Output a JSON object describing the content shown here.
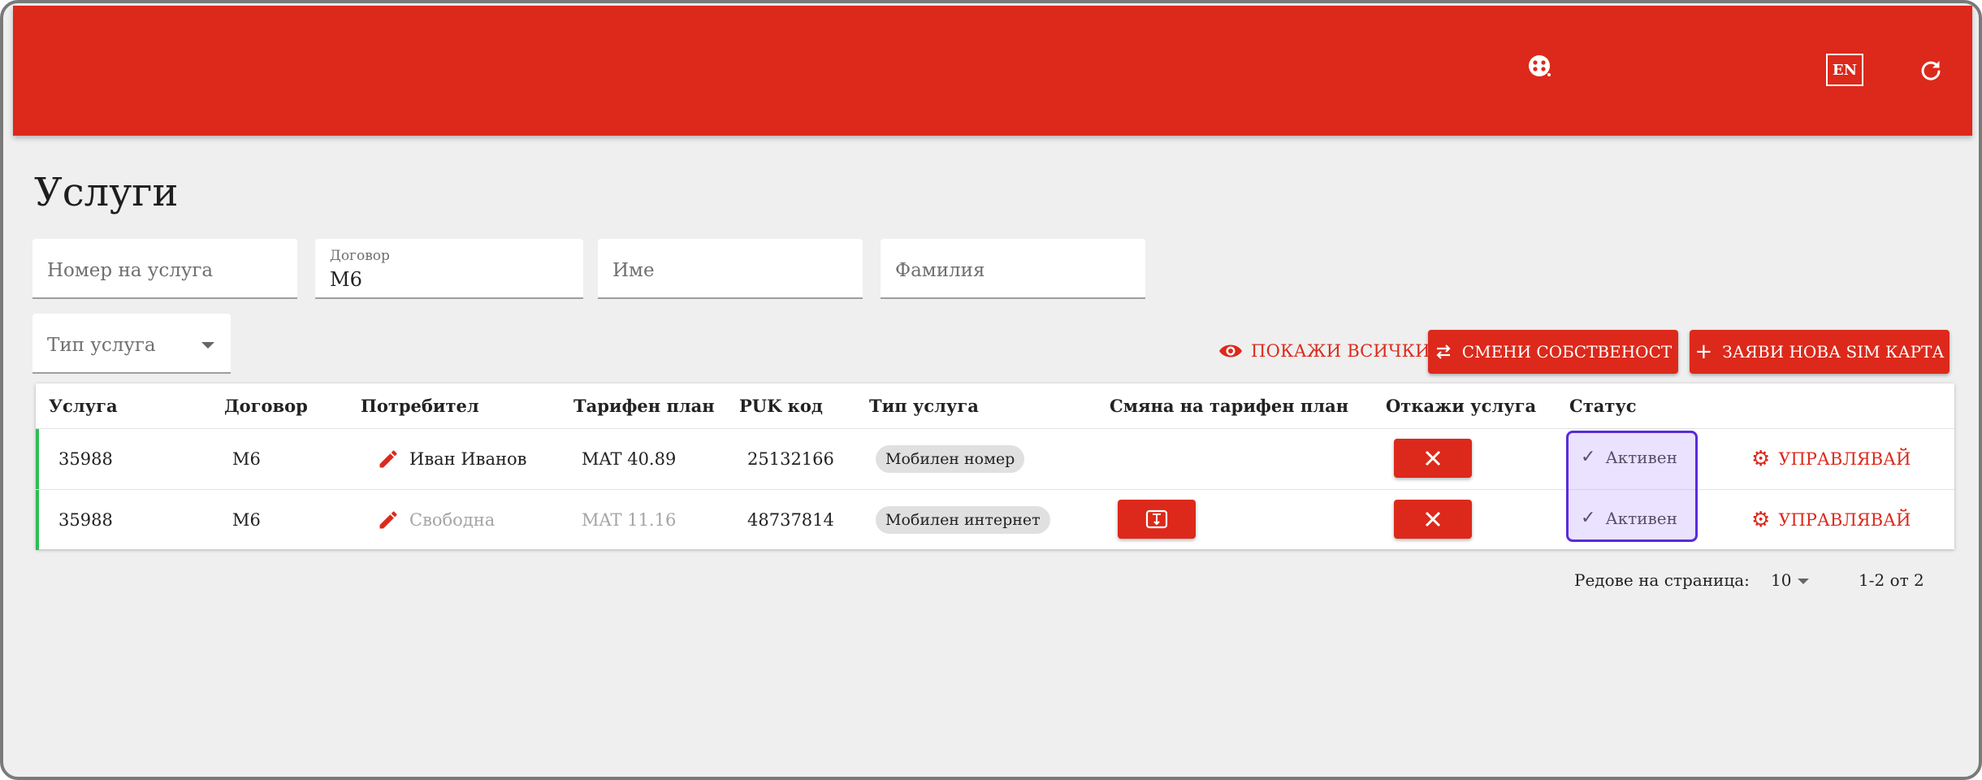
{
  "header": {
    "lang_label": "EN",
    "icons": [
      "support-icon",
      "refresh-icon"
    ],
    "color": "#dc291b"
  },
  "page": {
    "title": "Услуги"
  },
  "filters": {
    "service_number": {
      "placeholder": "Номер на услуга",
      "value": ""
    },
    "contract": {
      "label": "Договор",
      "value": "M6"
    },
    "first_name": {
      "placeholder": "Име",
      "value": ""
    },
    "last_name": {
      "placeholder": "Фамилия",
      "value": ""
    },
    "service_type": {
      "placeholder": "Тип услуга",
      "value": ""
    }
  },
  "actions": {
    "show_all": "ПОКАЖИ ВСИЧКИ",
    "change_ownership": "СМЕНИ СОБСТВЕНОСТ",
    "request_sim": "ЗАЯВИ НОВА SIM КАРТА"
  },
  "table": {
    "columns": [
      "Услуга",
      "Договор",
      "Потребител",
      "Тарифен план",
      "PUK код",
      "Тип услуга",
      "Смяна на тарифен план",
      "Откажи услуга",
      "Статус"
    ],
    "rows": [
      {
        "service": "35988",
        "contract": "M6",
        "user": "Иван Иванов",
        "user_muted": false,
        "plan": "MAT 40.89",
        "plan_muted": false,
        "puk": "25132166",
        "type": "Мобилен номер",
        "has_plan_change": false,
        "status": "Активен",
        "manage": "УПРАВЛЯВАЙ"
      },
      {
        "service": "35988",
        "contract": "M6",
        "user": "Свободна",
        "user_muted": true,
        "plan": "MAT 11.16",
        "plan_muted": true,
        "puk": "48737814",
        "type": "Мобилен интернет",
        "has_plan_change": true,
        "status": "Активен",
        "manage": "УПРАВЛЯВАЙ"
      }
    ]
  },
  "pagination": {
    "rows_per_page_label": "Редове на страница:",
    "rows_per_page": "10",
    "range": "1-2 от 2"
  }
}
